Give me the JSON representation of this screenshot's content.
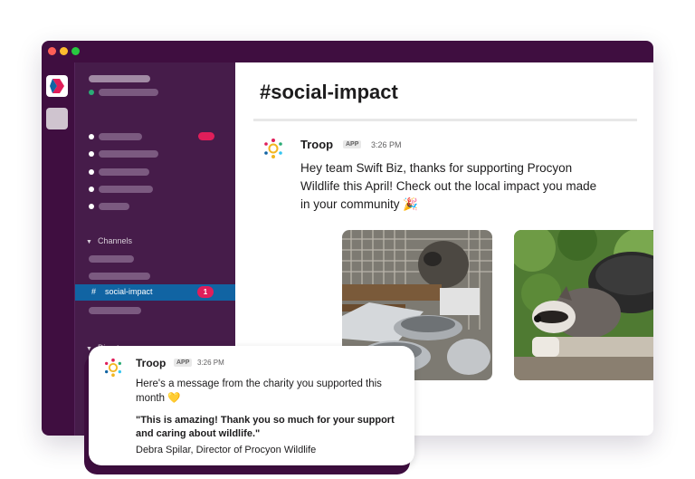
{
  "channel": {
    "title": "#social-impact"
  },
  "sidebar": {
    "channels_header": "Channels",
    "direct_messages_header": "Direct messages",
    "active_channel": {
      "hash": "#",
      "name": "social-impact",
      "unread_count": "1"
    }
  },
  "message": {
    "sender": "Troop",
    "app_badge": "APP",
    "time": "3:26 PM",
    "text": "Hey team Swift Biz, thanks for supporting Procyon Wildlife this April! Check out the local impact you made in your community 🎉",
    "images": [
      {
        "icon": "raccoon-in-cage-photo"
      },
      {
        "icon": "raccoon-in-bucket-photo"
      }
    ]
  },
  "popup": {
    "sender": "Troop",
    "app_badge": "APP",
    "time": "3:26 PM",
    "intro": "Here's a message from the charity you supported this month 💛",
    "quote": "\"This is amazing! Thank you so much for your support and caring about wildlife.\"",
    "attribution": "Debra Spilar, Director of Procyon Wildlife"
  },
  "colors": {
    "sidebar": "#461c4a",
    "titlebar": "#3f0e40",
    "active_channel": "#1164a3",
    "badge": "#e01e5a",
    "online": "#2bac76"
  }
}
